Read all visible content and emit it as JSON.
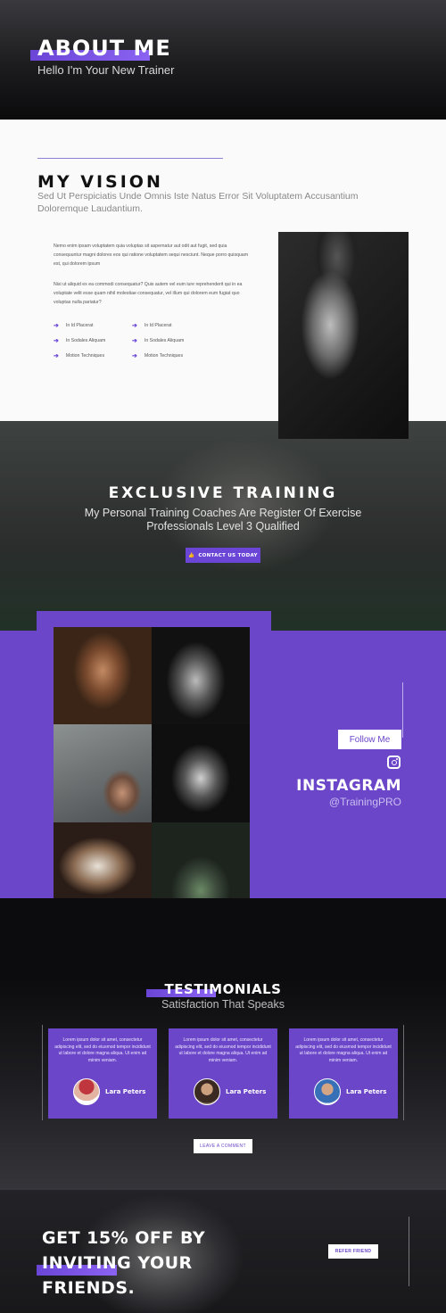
{
  "hero": {
    "title": "ABOUT ME",
    "subtitle": "Hello I'm Your New Trainer"
  },
  "vision": {
    "title": "MY VISION",
    "subtitle": "Sed Ut Perspiciatis Unde Omnis Iste Natus Error Sit Voluptatem Accusantium Doloremque Laudantium.",
    "para1": "Nemo enim ipsam voluptatem quia voluptas sit aspernatur aut odit aut fugit, sed quia consequuntur magni dolores eos qui ratione voluptatem sequi nesciunt. Neque porro quisquam est, qui dolorem ipsum",
    "para2": "Nisi ut aliquid ex ea commodi consequatur? Quis autem vel eum iure reprehenderit qui in ea voluptate velit esse quam nihil molestiae consequatur, vel illum qui dolorem eum fugiat quo voluptas nulla pariatur?",
    "list": [
      "In Id Placerat",
      "In Id Placerat",
      "In Sodales Aliquam",
      "In Sodales Aliquam",
      "Motion Techniques",
      "Motion Techniques"
    ]
  },
  "exclusive": {
    "title": "EXCLUSIVE TRAINING",
    "subtitle": "My Personal Training Coaches Are Register Of Exercise Professionals Level 3 Qualified",
    "button": "CONTACT US TODAY",
    "button_icon": "thumbs-up-icon"
  },
  "instagram": {
    "follow": "Follow Me",
    "title": "INSTAGRAM",
    "handle": "@TrainingPRO",
    "icon": "instagram-icon"
  },
  "testimonials": {
    "title": "TESTIMONIALS",
    "subtitle": "Satisfaction That Speaks",
    "cards": [
      {
        "quote": "Lorem ipsum dolor sit amet, consectetur adipiscing elit, sed do eiusmod tempor incididunt ut labore et dolore magna aliqua. Ut enim ad minim veniam.",
        "name": "Lara Peters"
      },
      {
        "quote": "Lorem ipsum dolor sit amet, consectetur adipiscing elit, sed do eiusmod tempor incididunt ut labore et dolore magna aliqua. Ut enim ad minim veniam.",
        "name": "Lara Peters"
      },
      {
        "quote": "Lorem ipsum dolor sit amet, consectetur adipiscing elit, sed do eiusmod tempor incididunt ut labore et dolore magna aliqua. Ut enim ad minim veniam.",
        "name": "Lara Peters"
      }
    ],
    "button": "LEAVE A COMMENT"
  },
  "promo": {
    "title": "GET 15% OFF BY INVITING YOUR FRIENDS.",
    "button": "REFER FRIEND"
  },
  "colors": {
    "accent": "#6b46c8",
    "dark": "#0c0c0e"
  }
}
